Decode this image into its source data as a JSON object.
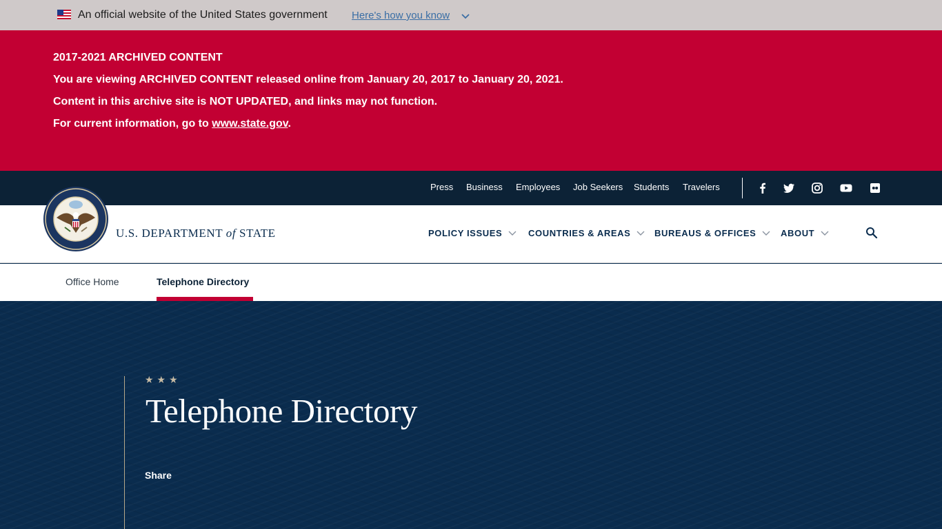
{
  "gov_banner": {
    "text": "An official website of the United States government",
    "link": "Here's how you know"
  },
  "archive": {
    "line1": "2017-2021 ARCHIVED CONTENT",
    "line2": "You are viewing ARCHIVED CONTENT released online from January 20, 2017 to January 20, 2021.",
    "line3": "Content in this archive site is NOT UPDATED, and links may not function.",
    "line4_prefix": "For current information, go to ",
    "line4_link": "www.state.gov",
    "line4_suffix": "."
  },
  "utility_nav": {
    "press": "Press",
    "business": "Business",
    "employees": "Employees",
    "job_seekers": "Job Seekers",
    "students": "Students",
    "travelers": "Travelers"
  },
  "social_icons": [
    "facebook-icon",
    "twitter-icon",
    "instagram-icon",
    "youtube-icon",
    "flickr-icon"
  ],
  "header": {
    "dept_prefix": "U.S. DEPARTMENT ",
    "dept_of": "of",
    "dept_suffix": " STATE"
  },
  "main_nav": {
    "policy_issues": "POLICY ISSUES",
    "countries_areas": "COUNTRIES & AREAS",
    "bureaus_offices": "BUREAUS & OFFICES",
    "about": "ABOUT"
  },
  "sub_nav": {
    "office_home": "Office Home",
    "telephone_directory": "Telephone Directory"
  },
  "hero": {
    "stars": "★★★",
    "title": "Telephone Directory",
    "share": "Share"
  },
  "colors": {
    "archive_red": "#c20033",
    "navy": "#0a2c4e",
    "utility_bg": "#0c2236",
    "gov_banner_bg": "#cfc9c9"
  }
}
